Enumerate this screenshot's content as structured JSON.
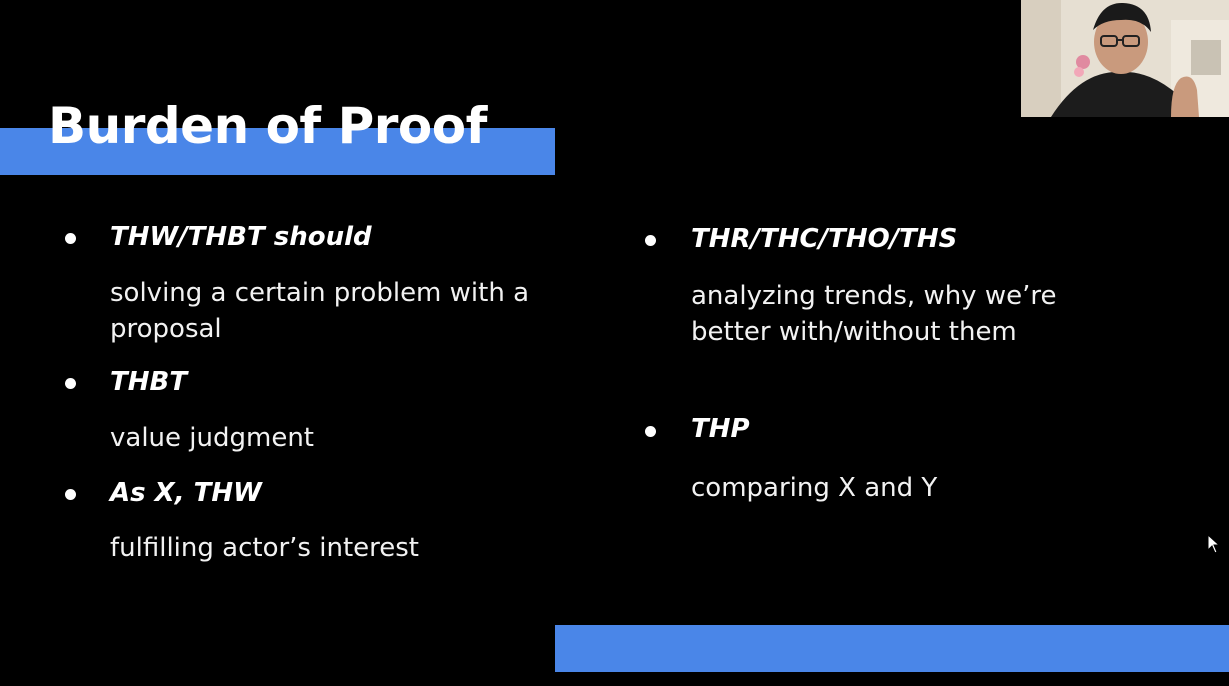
{
  "slide": {
    "title": "Burden of Proof",
    "left_column": [
      {
        "heading": "THW/THBT should",
        "description": "solving a certain problem with a proposal"
      },
      {
        "heading": "THBT",
        "description": "value judgment"
      },
      {
        "heading": "As X, THW",
        "description": "fulfilling actor’s interest"
      }
    ],
    "right_column": [
      {
        "heading": "THR/THC/THO/THS",
        "description": "analyzing trends, why we’re better with/without them"
      },
      {
        "heading": "THP",
        "description": "comparing X and Y"
      }
    ]
  },
  "colors": {
    "background": "#000000",
    "accent_bar": "#4a86e8",
    "text": "#ffffff"
  },
  "icons": {
    "bullet": "bullet-dot-icon",
    "cursor": "mouse-pointer-icon",
    "webcam": "webcam-video-feed"
  }
}
